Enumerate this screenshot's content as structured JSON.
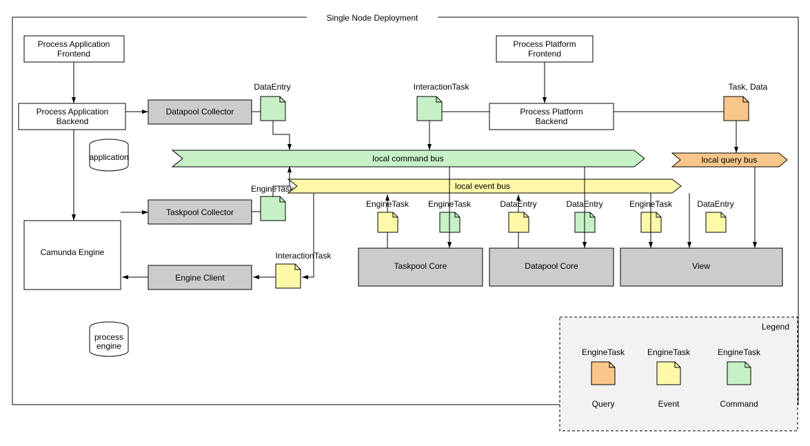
{
  "title": "Single Node Deployment",
  "components": {
    "paFrontend": "Process Application\nFrontend",
    "paBackend": "Process Application\nBackend",
    "datapoolCollector": "Datapool Collector",
    "taskpoolCollector": "Taskpool Collector",
    "engineClient": "Engine Client",
    "camunda": "Camunda Engine",
    "ppFrontend": "Process Platform\nFrontend",
    "ppBackend": "Process Platform\nBackend",
    "taskpoolCore": "Taskpool Core",
    "datapoolCore": "Datapool Core",
    "view": "View"
  },
  "dbs": {
    "application": "application",
    "processEngine": "process\nengine"
  },
  "buses": {
    "command": "local command bus",
    "event": "local event bus",
    "query": "local query bus"
  },
  "files": {
    "dataEntry": "DataEntry",
    "engineTask": "EngineTask",
    "interactionTask": "InteractionTask",
    "taskData": "Task, Data"
  },
  "legend": {
    "title": "Legend",
    "query": "Query",
    "event": "Event",
    "command": "Command",
    "engineTask": "EngineTask"
  }
}
